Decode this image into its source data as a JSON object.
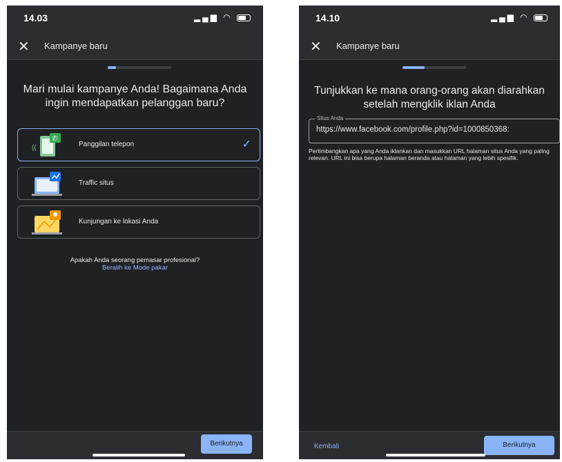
{
  "screen1": {
    "status": {
      "time": "14.03"
    },
    "appbar": {
      "title": "Kampanye baru"
    },
    "heading": "Mari mulai kampanye Anda! Bagaimana Anda ingin mendapatkan pelanggan baru?",
    "options": [
      {
        "label": "Panggilan telepon",
        "icon": "phone-call-illustration",
        "selected": true
      },
      {
        "label": "Traffic situs",
        "icon": "website-traffic-illustration",
        "selected": false
      },
      {
        "label": "Kunjungan ke lokasi Anda",
        "icon": "map-location-illustration",
        "selected": false
      }
    ],
    "pro_question": "Apakah Anda seorang pemasar profesional?",
    "pro_link": "Beralih ke Mode pakar",
    "next_label": "Berikutnya",
    "progress": 0.12
  },
  "screen2": {
    "status": {
      "time": "14.10"
    },
    "appbar": {
      "title": "Kampanye baru"
    },
    "heading": "Tunjukkan ke mana orang-orang akan diarahkan setelah mengklik iklan Anda",
    "field": {
      "label": "Situs Anda",
      "value": "https://www.facebook.com/profile.php?id=1000850368:"
    },
    "hint": "Pertimbangkan apa yang Anda iklankan dan masukkan URL halaman situs Anda yang paling relevan. URL ini bisa berupa halaman beranda atau halaman yang lebih spesifik.",
    "back_label": "Kembali",
    "next_label": "Berikutnya",
    "progress": 0.35
  },
  "colors": {
    "accent": "#8ab4f8",
    "background": "#202124",
    "bar": "#2c2d30"
  }
}
